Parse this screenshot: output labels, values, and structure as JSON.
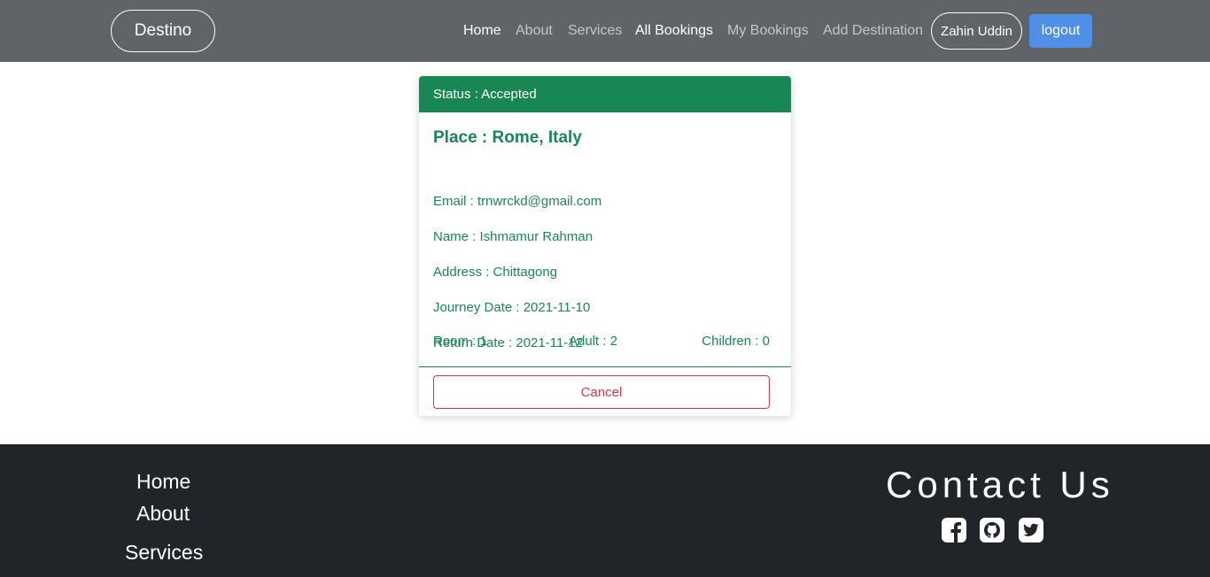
{
  "navbar": {
    "brand": "Destino",
    "links": [
      "Home",
      "About",
      "Services",
      "All Bookings",
      "My Bookings",
      "Add Destination"
    ],
    "user": "Zahin Uddin",
    "logout": "logout"
  },
  "booking": {
    "status": "Status : Accepted",
    "place": "Place : Rome, Italy",
    "email": "Email : trnwrckd@gmail.com",
    "name": "Name : Ishmamur Rahman",
    "address": "Address : Chittagong",
    "journey_date": "Journey Date : 2021-11-10",
    "return_date": "Return Date : 2021-11-12",
    "room": "Room : 1",
    "adult": "Adult : 2",
    "children": "Children : 0",
    "cancel": "Cancel"
  },
  "footer": {
    "links": [
      "Home",
      "About",
      "Services"
    ],
    "contact_title": "Contact Us",
    "social_icons": [
      "facebook-icon",
      "github-icon",
      "twitter-icon"
    ]
  },
  "colors": {
    "navbar_bg": "#606468",
    "status_green": "#198754",
    "logout_blue": "#4f8fe6",
    "cancel_red": "#dc3545",
    "footer_bg": "#212529"
  }
}
